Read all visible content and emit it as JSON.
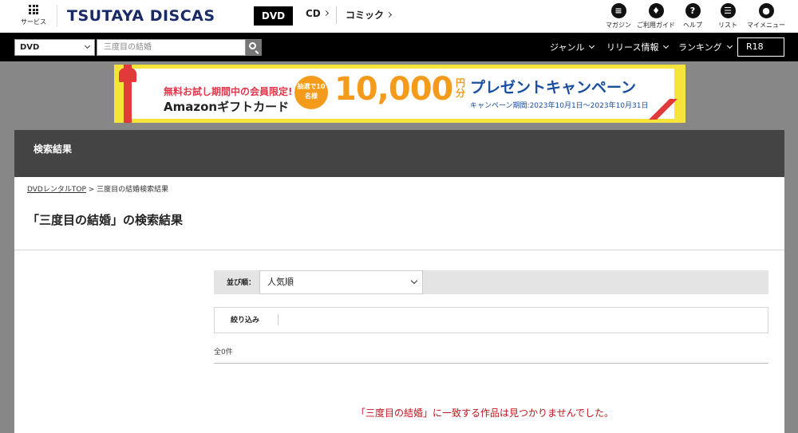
{
  "header": {
    "service_label": "サービス",
    "logo_text": "TSUTAYA DISCAS",
    "nav": [
      {
        "label": "DVD",
        "active": true
      },
      {
        "label": "CD"
      },
      {
        "label": "コミック"
      }
    ],
    "utility": [
      {
        "label": "マガジン",
        "icon": "magazine-icon"
      },
      {
        "label": "ご利用ガイド",
        "icon": "guide-icon"
      },
      {
        "label": "ヘルプ",
        "icon": "help-icon",
        "glyph": "?"
      },
      {
        "label": "リスト",
        "icon": "list-icon"
      },
      {
        "label": "マイメニュー",
        "icon": "user-icon"
      }
    ]
  },
  "search": {
    "category_value": "DVD",
    "query_value": "三度目の結婚",
    "menus": [
      {
        "label": "ジャンル"
      },
      {
        "label": "リリース情報"
      },
      {
        "label": "ランキング"
      }
    ],
    "r18_label": "R18"
  },
  "banner": {
    "line1": "無料お試し期間中の会員限定!",
    "line2": "Amazonギフトカード",
    "badge": "抽選で10名様",
    "amount": "10,000",
    "unit": "円分",
    "title": "プレゼントキャンペーン",
    "period": "キャンペーン期間:2023年10月1日〜2023年10月31日",
    "colors": {
      "frame": "#f7e43a",
      "amount": "#f59b1c",
      "title": "#1a4fa0",
      "ribbon": "#e23a3a"
    }
  },
  "results": {
    "header": "検索結果",
    "breadcrumb_home": "DVDレンタルTOP",
    "breadcrumb_sep": " > ",
    "breadcrumb_current": "三度目の結婚検索結果",
    "page_title": "「三度目の結婚」の検索結果",
    "sort_label": "並び順：",
    "sort_value": "人気順",
    "filter_label": "絞り込み",
    "count": "全0件",
    "no_result": "「三度目の結婚」に一致する作品は見つかりませんでした。"
  }
}
